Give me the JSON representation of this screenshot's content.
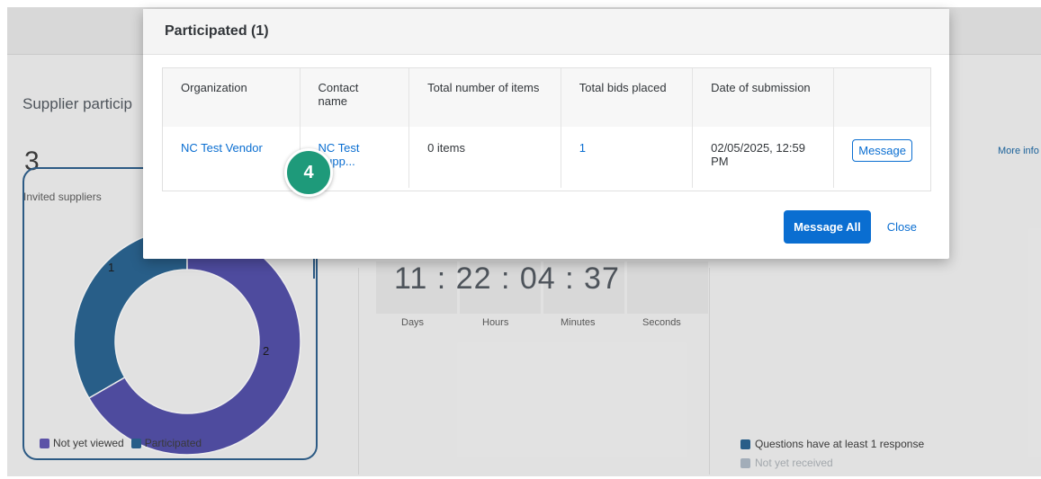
{
  "background": {
    "section_title": "Supplier particip",
    "invited_count": "3",
    "invited_label": "Invited suppliers",
    "donut": {
      "segments": [
        {
          "label": "1",
          "value": 1,
          "color": "#1f5d8c"
        },
        {
          "label": "2",
          "value": 2,
          "color": "#4b47a6"
        }
      ]
    },
    "legend": [
      {
        "label": "Not yet viewed",
        "color": "#5a4fb0"
      },
      {
        "label": "Participated",
        "color": "#1f5d8c"
      }
    ],
    "countdown": {
      "days": "11",
      "hours": "22",
      "minutes": "04",
      "seconds": "37",
      "sep": ":",
      "days_label": "Days",
      "hours_label": "Hours",
      "minutes_label": "Minutes",
      "seconds_label": "Seconds"
    },
    "more_info": "More info",
    "right_legend": [
      {
        "label": "Questions have at least 1 response",
        "color": "#1f5d8c"
      },
      {
        "label": "Not yet received",
        "color": "#aab7c4"
      }
    ]
  },
  "callout": {
    "number": "4"
  },
  "modal": {
    "title": "Participated (1)",
    "columns": [
      "Organization",
      "Contact name",
      "Total number of items",
      "Total bids placed",
      "Date of submission",
      ""
    ],
    "rows": [
      {
        "organization": "NC Test Vendor",
        "contact": "NC Test Supp...",
        "items": "0 items",
        "bids": "1",
        "date": "02/05/2025, 12:59 PM",
        "action": "Message"
      }
    ],
    "message_all": "Message All",
    "close": "Close"
  }
}
